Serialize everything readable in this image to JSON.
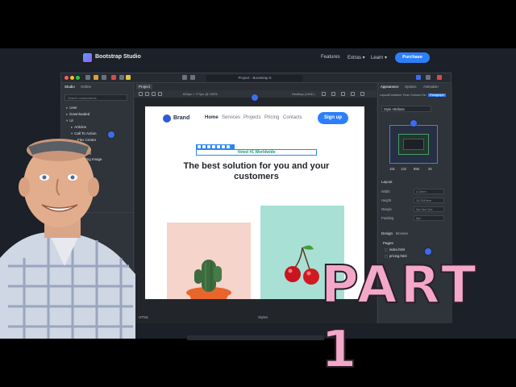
{
  "site": {
    "logo_text": "Bootstrap Studio",
    "nav": [
      "Features",
      "Extras ▾",
      "Learn ▾"
    ],
    "purchase_label": "Purchase"
  },
  "app": {
    "window_title": "Project - Bootstrap 5",
    "left_panel": {
      "tabs": [
        "Studio",
        "Online"
      ],
      "search_placeholder": "Search components",
      "tree": [
        "User",
        "Downloaded",
        "UI",
        "Articles",
        "Call To Action",
        "Flex Center",
        "Color",
        "Heading",
        "Heading Image",
        "Light"
      ]
    },
    "canvas": {
      "tab": "Project",
      "size_label": "820px × 771px @ 100%",
      "width_label": "Desktop (1400 )"
    },
    "page": {
      "brand": "Brand",
      "nav": [
        "Home",
        "Services",
        "Projects",
        "Pricing",
        "Contacts"
      ],
      "signup": "Sign up",
      "badge": "Voted #1 Worldwide",
      "headline": "The best solution for you and your customers"
    },
    "right_panel": {
      "tabs": [
        "Appearance",
        "Options",
        "Animation"
      ],
      "subtabs": [
        "Layout",
        "Container",
        "Row",
        "Column",
        "Div",
        "Paragraph"
      ],
      "style_field": "Style Attribute",
      "box_numbers": [
        "191",
        "132",
        "856",
        "26"
      ],
      "layout_head": "Layout",
      "layout_rows": [
        {
          "label": "Width",
          "value": "4.15em"
        },
        {
          "label": "Height",
          "value": "10.2949em"
        },
        {
          "label": "Margin",
          "value": "0px 0px 0px"
        },
        {
          "label": "Padding",
          "value": "0px"
        }
      ],
      "design_tabs": [
        "Design",
        "Browse"
      ],
      "pages_head": "Pages",
      "files": [
        "index.html",
        "pricing.html"
      ]
    },
    "bottom_tabs": [
      "HTML",
      "Styles"
    ]
  },
  "overlay_text": "PART 1",
  "colors": {
    "accent": "#2d7ff9",
    "badge_green": "#1a9e66",
    "overlay_pink": "#f4a8c8",
    "card_pink": "#f4d4cb",
    "card_mint": "#a8e0d6"
  }
}
